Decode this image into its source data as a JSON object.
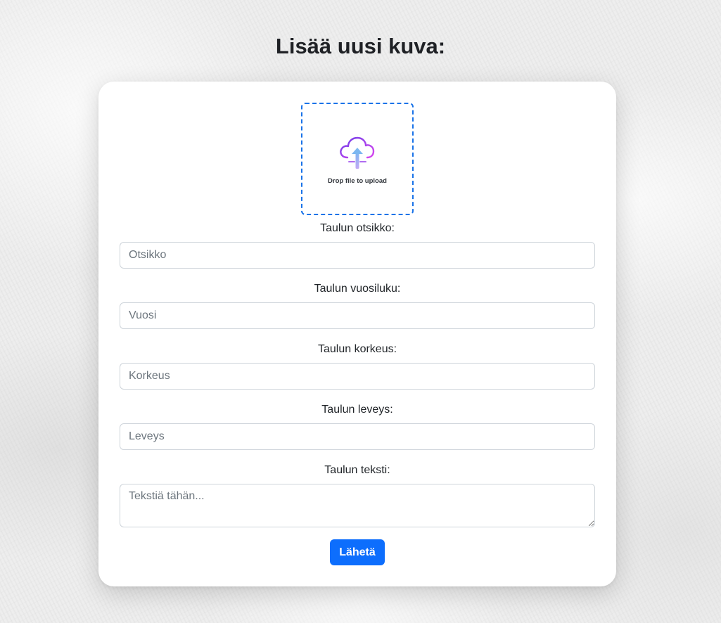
{
  "page": {
    "title": "Lisää uusi kuva:"
  },
  "upload": {
    "icon": "cloud-upload-icon",
    "text": "Drop file to upload",
    "border_color": "#1a73e8"
  },
  "form": {
    "title": {
      "label": "Taulun otsikko:",
      "placeholder": "Otsikko",
      "value": ""
    },
    "year": {
      "label": "Taulun vuosiluku:",
      "placeholder": "Vuosi",
      "value": ""
    },
    "height": {
      "label": "Taulun korkeus:",
      "placeholder": "Korkeus",
      "value": ""
    },
    "width": {
      "label": "Taulun leveys:",
      "placeholder": "Leveys",
      "value": ""
    },
    "text": {
      "label": "Taulun teksti:",
      "placeholder": "Tekstiä tähän...",
      "value": ""
    },
    "submit_label": "Lähetä"
  },
  "colors": {
    "primary": "#0d6efd",
    "icon_gradient_start": "#7b3fe4",
    "icon_gradient_end": "#d946ef",
    "arrow": "#7cb7f0"
  }
}
